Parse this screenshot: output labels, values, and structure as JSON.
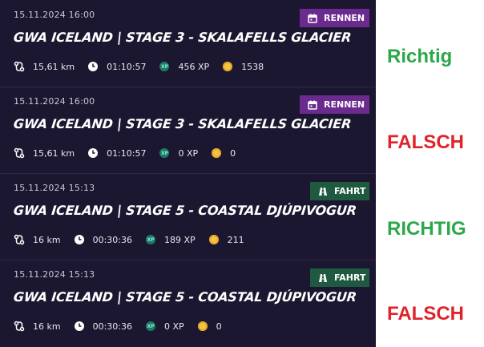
{
  "entries": [
    {
      "date": "15.11.2024 16:00",
      "badge": "RENNEN",
      "badge_type": "race",
      "title": "GWA ICELAND |  STAGE 3 - SKALAFELLS GLACIER",
      "distance": "15,61 km",
      "duration": "01:10:57",
      "xp": "456 XP",
      "coins": "1538",
      "verdict": "Richtig"
    },
    {
      "date": "15.11.2024 16:00",
      "badge": "RENNEN",
      "badge_type": "race",
      "title": "GWA ICELAND |  STAGE 3 - SKALAFELLS GLACIER",
      "distance": "15,61 km",
      "duration": "01:10:57",
      "xp": "0 XP",
      "coins": "0",
      "verdict": "FALSCH"
    },
    {
      "date": "15.11.2024 15:13",
      "badge": "FAHRT",
      "badge_type": "ride",
      "title": "GWA ICELAND |  STAGE 5 - COASTAL DJÚPIVOGUR",
      "distance": "16 km",
      "duration": "00:30:36",
      "xp": "189 XP",
      "coins": "211",
      "verdict": "RICHTIG"
    },
    {
      "date": "15.11.2024 15:13",
      "badge": "FAHRT",
      "badge_type": "ride",
      "title": "GWA ICELAND |  STAGE 5 - COASTAL DJÚPIVOGUR",
      "distance": "16 km",
      "duration": "00:30:36",
      "xp": "0 XP",
      "coins": "0",
      "verdict": "FALSCH"
    }
  ],
  "icons": {
    "distance": "route-icon",
    "duration": "clock-icon",
    "xp": "xp-icon",
    "coins": "coin-icon",
    "race_badge": "calendar-icon",
    "ride_badge": "road-icon"
  },
  "colors": {
    "panel_bg": "#1c1730",
    "race_badge": "#6b2a8e",
    "ride_badge": "#1f5a40",
    "verdict_correct": "#2aa84a",
    "verdict_wrong": "#e0232a"
  }
}
